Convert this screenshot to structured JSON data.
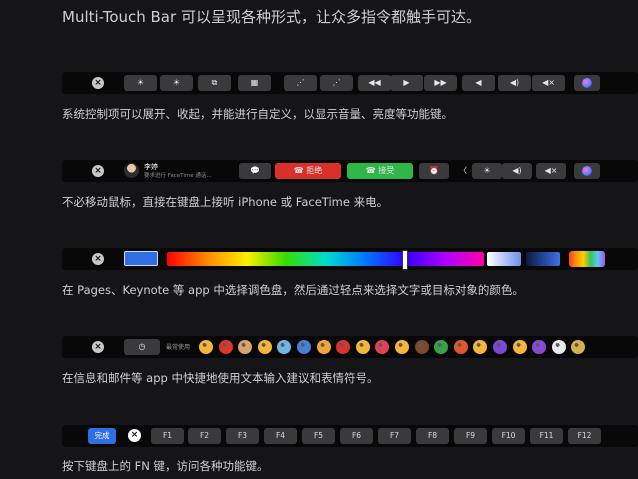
{
  "heading": "Multi-Touch Bar 可以呈现各种形式，让众多指令都触手可达。",
  "captions": [
    "系统控制项可以展开、收起，并能进行自定义，以显示音量、亮度等功能键。",
    "不必移动鼠标，直接在键盘上接听 iPhone 或 FaceTime 来电。",
    "在 Pages、Keynote 等 app 中选择调色盘，然后通过轻点来选择文字或目标对象的颜色。",
    "在信息和邮件等 app 中快捷地使用文本输入建议和表情符号。",
    "按下键盘上的 FN 键，访问各种功能键。"
  ],
  "system_bar": {
    "keys": [
      "☀",
      "☀",
      "⧉",
      "▦",
      "⋰",
      "⋰",
      "◀◀",
      "▶",
      "▶▶",
      "◀",
      "◀)",
      "◀×"
    ]
  },
  "call_bar": {
    "caller_name": "李婷",
    "caller_status": "要求进行 FaceTime 通话...",
    "message_icon": "💬",
    "decline_label": "拒绝",
    "accept_label": "接受",
    "extra_keys": [
      "⏰",
      "〈",
      "☀",
      "◀)",
      "◀×"
    ]
  },
  "emoji_bar": {
    "label": "最常使用",
    "emojis": [
      "#f3b63a",
      "#e0352b",
      "#d9a46a",
      "#f3b63a",
      "#6fb6e0",
      "#4a7fd6",
      "#f3a53a",
      "#d9342b",
      "#f3b63a",
      "#e0405a",
      "#f3b63a",
      "#7a4a2a",
      "#3aa34a",
      "#e0572b",
      "#f3b63a",
      "#7a4ad6",
      "#f3b63a",
      "#8a4ad6",
      "#e8e8e8",
      "#d6b04a"
    ]
  },
  "fn_bar": {
    "done_label": "完成",
    "fkeys": [
      "F1",
      "F2",
      "F3",
      "F4",
      "F5",
      "F6",
      "F7",
      "F8",
      "F9",
      "F10",
      "F11",
      "F12"
    ]
  },
  "colors": {
    "accent_blue": "#2f6fe6",
    "decline_red": "#d8312c",
    "accept_green": "#2fb548"
  }
}
